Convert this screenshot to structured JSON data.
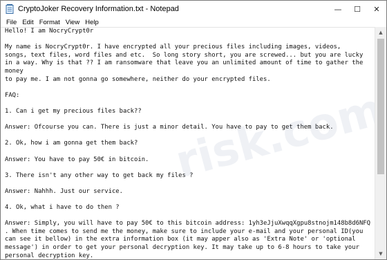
{
  "window": {
    "title": "CryptoJoker Recovery Information.txt - Notepad",
    "app_icon": "notepad-icon",
    "controls": {
      "minimize": "—",
      "maximize": "☐",
      "close": "✕"
    }
  },
  "menu": [
    "File",
    "Edit",
    "Format",
    "View",
    "Help"
  ],
  "editor": {
    "lines": [
      "Hello! I am NocryCrypt0r",
      "",
      "My name is NocryCrypt0r. I have encrypted all your precious files including images, videos,",
      "songs, text files, word files and etc.  So long story short, you are screwed... but you are lucky",
      "in a way. Why is that ?? I am ransomware that leave you an unlimited amount of time to gather the",
      "money",
      "to pay me. I am not gonna go somewhere, neither do your encrypted files.",
      "",
      "FAQ:",
      "",
      "1. Can i get my precious files back??",
      "",
      "Answer: Ofcourse you can. There is just a minor detail. You have to pay to get them back.",
      "",
      "2. Ok, how i am gonna get them back?",
      "",
      "Answer: You have to pay 50€ in bitcoin.",
      "",
      "3. There isn't any other way to get back my files ?",
      "",
      "Answer: Nahhh. Just our service.",
      "",
      "4. Ok, what i have to do then ?",
      "",
      "Answer: Simply, you will have to pay 50€ to this bitcoin address: 1yh3eJjuXwqqXgpu8stnojm148b8d6NFQ",
      ". When time comes to send me the money, make sure to include your e-mail and your personal ID(you",
      "can see it bellow) in the extra information box (it may apper also as 'Extra Note' or 'optional",
      "message') in order to get your personal decryption key. It may take up to 6-8 hours to take your",
      "personal decryption key."
    ]
  },
  "scrollbar": {
    "up": "▲",
    "down": "▼"
  },
  "watermark": "risk.com"
}
